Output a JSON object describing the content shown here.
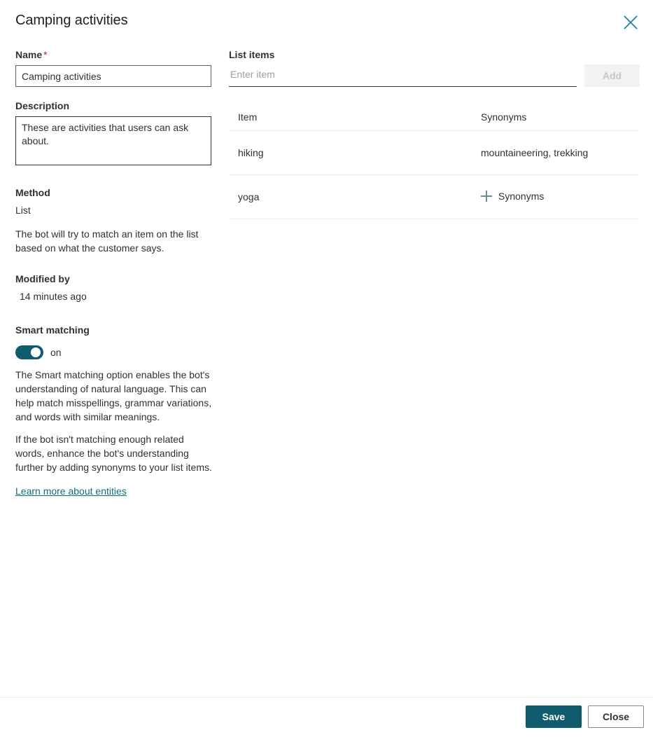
{
  "header": {
    "title": "Camping activities",
    "close_icon": "close-icon"
  },
  "left": {
    "name": {
      "label": "Name",
      "required_marker": "*",
      "value": "Camping activities"
    },
    "description": {
      "label": "Description",
      "value": "These are activities that users can ask about."
    },
    "method": {
      "label": "Method",
      "value": "List",
      "help": "The bot will try to match an item on the list based on what the customer says."
    },
    "modified_by": {
      "label": "Modified by",
      "value": "14 minutes ago"
    },
    "smart_matching": {
      "label": "Smart matching",
      "toggle_state": "on",
      "toggle_color": "#0f5c6e",
      "paragraph_1": "The Smart matching option enables the bot's understanding of natural language. This can help match misspellings, grammar variations, and words with similar meanings.",
      "paragraph_2": "If the bot isn't matching enough related words, enhance the bot's understanding further by adding synonyms to your list items.",
      "link_text": "Learn more about entities",
      "link_color": "#0f6c81"
    }
  },
  "right": {
    "list_items": {
      "label": "List items",
      "input_placeholder": "Enter item",
      "input_value": "",
      "add_button_label": "Add",
      "add_button_disabled": true
    },
    "table": {
      "columns": [
        "Item",
        "Synonyms"
      ],
      "rows": [
        {
          "item": "hiking",
          "synonyms": "mountaineering, trekking",
          "has_add_synonyms": false
        },
        {
          "item": "yoga",
          "synonyms": "",
          "has_add_synonyms": true,
          "add_synonyms_label": "Synonyms"
        }
      ]
    }
  },
  "footer": {
    "save_label": "Save",
    "close_label": "Close",
    "primary_color": "#0f5c6e"
  }
}
